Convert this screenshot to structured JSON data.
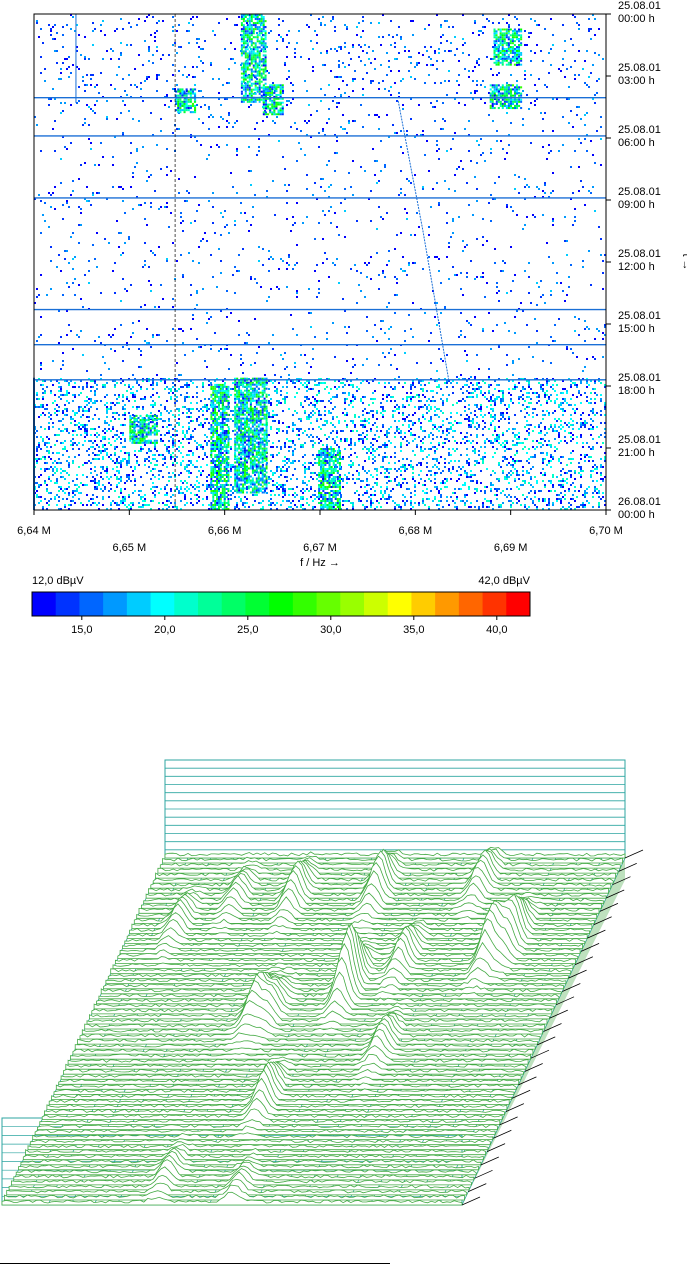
{
  "chart_data": [
    {
      "type": "heatmap",
      "title": "",
      "x": {
        "label": "f / Hz →",
        "min": 6.64,
        "max": 6.7,
        "ticks": [
          {
            "value": 6.64,
            "label": "6,64 M"
          },
          {
            "value": 6.65,
            "label": "6,65 M"
          },
          {
            "value": 6.66,
            "label": "6,66 M"
          },
          {
            "value": 6.67,
            "label": "6,67 M"
          },
          {
            "value": 6.68,
            "label": "6,68 M"
          },
          {
            "value": 6.69,
            "label": "6,69 M"
          },
          {
            "value": 6.7,
            "label": "6,70 M"
          }
        ]
      },
      "y": {
        "label": "t →",
        "min_hours": 0,
        "max_hours": 24,
        "ticks": [
          {
            "hours": 0,
            "date": "25.08.01",
            "time": "00:00 h"
          },
          {
            "hours": 3,
            "date": "25.08.01",
            "time": "03:00 h"
          },
          {
            "hours": 6,
            "date": "25.08.01",
            "time": "06:00 h"
          },
          {
            "hours": 9,
            "date": "25.08.01",
            "time": "09:00 h"
          },
          {
            "hours": 12,
            "date": "25.08.01",
            "time": "12:00 h"
          },
          {
            "hours": 15,
            "date": "25.08.01",
            "time": "15:00 h"
          },
          {
            "hours": 18,
            "date": "25.08.01",
            "time": "18:00 h"
          },
          {
            "hours": 21,
            "date": "25.08.01",
            "time": "21:00 h"
          },
          {
            "hours": 24,
            "date": "26.08.01",
            "time": "00:00 h"
          }
        ]
      },
      "horizontal_bands_hours": [
        4.05,
        5.9,
        8.9,
        14.3,
        16.0,
        17.7
      ],
      "activity_blocks": [
        {
          "f0": 6.6617,
          "f1": 6.6644,
          "t0": 0.0,
          "t1": 4.3
        },
        {
          "f0": 6.6585,
          "f1": 6.6605,
          "t0": 17.9,
          "t1": 24.0
        },
        {
          "f0": 6.661,
          "f1": 6.6645,
          "t0": 17.6,
          "t1": 23.2
        },
        {
          "f0": 6.6882,
          "f1": 6.6912,
          "t0": 0.7,
          "t1": 2.5
        },
        {
          "f0": 6.6878,
          "f1": 6.6912,
          "t0": 3.4,
          "t1": 4.6
        },
        {
          "f0": 6.6548,
          "f1": 6.657,
          "t0": 3.6,
          "t1": 4.8
        },
        {
          "f0": 6.6698,
          "f1": 6.6722,
          "t0": 21.0,
          "t1": 24.0
        },
        {
          "f0": 6.664,
          "f1": 6.6662,
          "t0": 3.4,
          "t1": 4.9
        },
        {
          "f0": 6.65,
          "f1": 6.653,
          "t0": 19.4,
          "t1": 20.8
        }
      ],
      "colorbar": {
        "min": 12.0,
        "max": 42.0,
        "min_label": "12,0 dBµV",
        "max_label": "42,0 dBµV",
        "ticks": [
          {
            "value": 15.0,
            "label": "15,0"
          },
          {
            "value": 20.0,
            "label": "20,0"
          },
          {
            "value": 25.0,
            "label": "25,0"
          },
          {
            "value": 30.0,
            "label": "30,0"
          },
          {
            "value": 35.0,
            "label": "35,0"
          },
          {
            "value": 40.0,
            "label": "40,0"
          }
        ],
        "colors": [
          "#0000ff",
          "#0033ff",
          "#0066ff",
          "#0099ff",
          "#00ccff",
          "#00ffff",
          "#00ffcc",
          "#00ff99",
          "#00ff66",
          "#00ff33",
          "#00ff00",
          "#33ff00",
          "#66ff00",
          "#99ff00",
          "#ccff00",
          "#ffff00",
          "#ffcc00",
          "#ff9900",
          "#ff6600",
          "#ff3300",
          "#ff0000"
        ]
      }
    },
    {
      "type": "area",
      "title": "",
      "description_free": true,
      "trace_color": "#44aa44",
      "grid_color": "#2ca5a0",
      "peaks": [
        {
          "f": 6.6615,
          "t": 0.55,
          "h": 34
        },
        {
          "f": 6.6635,
          "t": 0.55,
          "h": 22
        },
        {
          "f": 6.672,
          "t": 0.62,
          "h": 60
        },
        {
          "f": 6.6775,
          "t": 0.7,
          "h": 28
        },
        {
          "f": 6.6885,
          "t": 0.72,
          "h": 46
        },
        {
          "f": 6.6905,
          "t": 0.76,
          "h": 38
        },
        {
          "f": 6.6595,
          "t": 0.88,
          "h": 30
        },
        {
          "f": 6.67,
          "t": 0.9,
          "h": 34
        },
        {
          "f": 6.683,
          "t": 0.92,
          "h": 26
        },
        {
          "f": 6.652,
          "t": 0.88,
          "h": 18
        },
        {
          "f": 6.646,
          "t": 0.8,
          "h": 20
        },
        {
          "f": 6.668,
          "t": 0.3,
          "h": 30
        },
        {
          "f": 6.68,
          "t": 0.45,
          "h": 24
        },
        {
          "f": 6.66,
          "t": 0.08,
          "h": 16
        },
        {
          "f": 6.67,
          "t": 0.04,
          "h": 14
        }
      ]
    }
  ]
}
